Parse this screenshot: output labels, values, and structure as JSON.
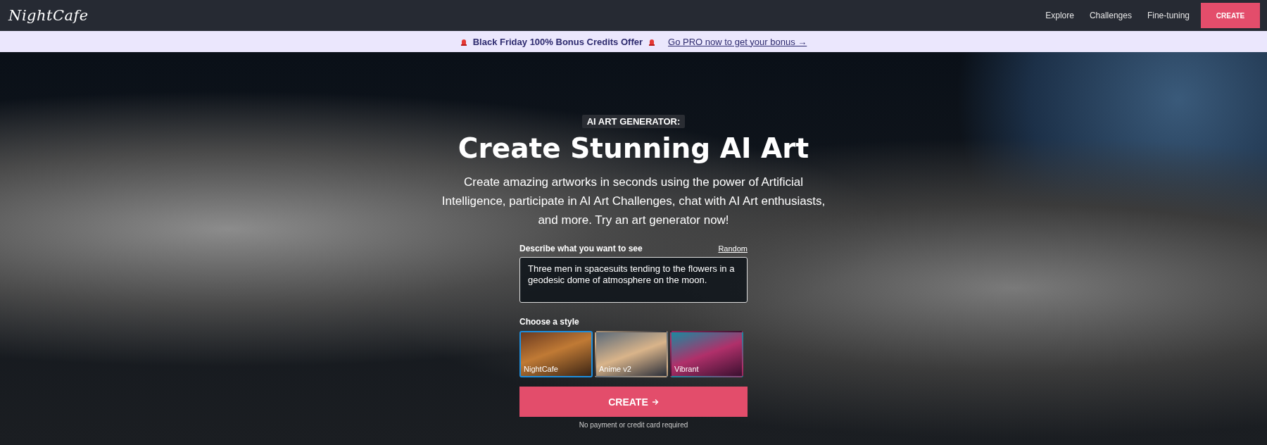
{
  "navbar": {
    "logo": "NightCafe",
    "links": [
      {
        "label": "Explore"
      },
      {
        "label": "Challenges"
      },
      {
        "label": "Fine-tuning"
      }
    ],
    "create_button": "CREATE"
  },
  "promo_banner": {
    "offer": "Black Friday 100% Bonus Credits Offer",
    "link": "Go PRO now to get your bonus →"
  },
  "hero": {
    "badge": "AI ART GENERATOR:",
    "title": "Create Stunning AI Art",
    "subtitle": "Create amazing artworks in seconds using the power of Artificial Intelligence, participate in AI Art Challenges, chat with AI Art enthusiasts, and more. Try an art generator now!",
    "prompt": {
      "label": "Describe what you want to see",
      "random_link": "Random",
      "value": "Three men in spacesuits tending to the flowers in a geodesic dome of atmosphere on the moon."
    },
    "style_label": "Choose a style",
    "styles": [
      {
        "name": "NightCafe",
        "selected": true
      },
      {
        "name": "Anime v2",
        "selected": false
      },
      {
        "name": "Vibrant",
        "selected": false
      }
    ],
    "create_button": "CREATE",
    "note": "No payment or credit card required"
  }
}
